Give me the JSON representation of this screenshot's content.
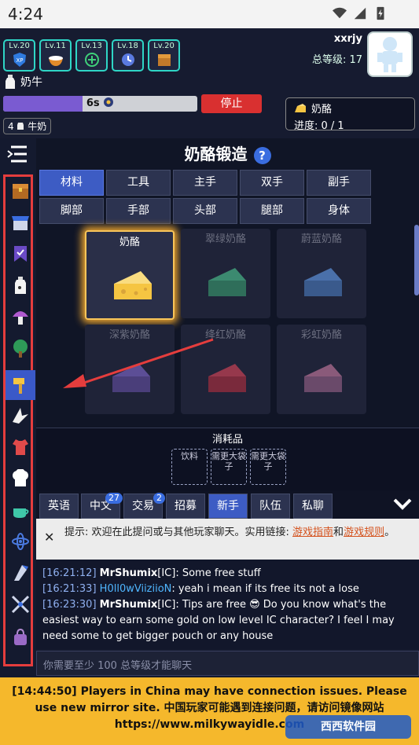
{
  "status_bar": {
    "time": "4:24"
  },
  "header": {
    "skills": [
      {
        "level": "Lv.20",
        "icon": "xp-shield-icon",
        "badge_text": "XP"
      },
      {
        "level": "Lv.11",
        "icon": "milk-bowl-icon"
      },
      {
        "level": "Lv.13",
        "icon": "plus-circle-icon"
      },
      {
        "level": "Lv.18",
        "icon": "clock-icon"
      },
      {
        "level": "Lv.20",
        "icon": "chest-icon"
      }
    ],
    "username": "xxrjy",
    "total_level": "总等级: 17",
    "current_action": "奶牛",
    "progress_text": "6s",
    "progress_fraction": 0.41,
    "stop_label": "停止",
    "queue": {
      "name": "奶酪",
      "progress": "进度: 0 / 1"
    },
    "item_count": "4",
    "item_name": "牛奶"
  },
  "main": {
    "title": "奶酪锻造",
    "tabs_row1": [
      "材料",
      "工具",
      "主手",
      "双手",
      "副手"
    ],
    "tabs_row2": [
      "脚部",
      "手部",
      "头部",
      "腿部",
      "身体"
    ],
    "active_tab": "材料",
    "tiles": [
      {
        "label": "奶酪",
        "selected": true,
        "color": "#f5c542"
      },
      {
        "label": "翠绿奶酪",
        "selected": false,
        "color": "#2f6e5a"
      },
      {
        "label": "蔚蓝奶酪",
        "selected": false,
        "color": "#3a5a8c"
      },
      {
        "label": "深紫奶酪",
        "selected": false,
        "color": "#4a3e7a"
      },
      {
        "label": "绛红奶酪",
        "selected": false,
        "color": "#7a2a3c"
      },
      {
        "label": "彩虹奶酪",
        "selected": false,
        "color": "#6a4a6a"
      }
    ]
  },
  "consumables": {
    "title": "消耗品",
    "slots": [
      "饮料",
      "需更大袋子",
      "需更大袋子"
    ]
  },
  "chat": {
    "tabs": [
      {
        "label": "英语",
        "count": ""
      },
      {
        "label": "中文",
        "count": "27"
      },
      {
        "label": "交易",
        "count": "2"
      },
      {
        "label": "招募",
        "count": ""
      },
      {
        "label": "新手",
        "count": ""
      },
      {
        "label": "队伍",
        "count": ""
      },
      {
        "label": "私聊",
        "count": ""
      }
    ],
    "active_tab": "新手",
    "tip_prefix": "提示: 欢迎在此提问或与其他玩家聊天。实用链接: ",
    "tip_link1": "游戏指南",
    "tip_and": "和",
    "tip_link2": "游戏规则",
    "tip_suffix": "。",
    "messages": [
      {
        "time": "[16:21:12]",
        "name": "MrShumix",
        "tag": "[IC]",
        "text": ": Some free stuff"
      },
      {
        "time": "[16:21:33]",
        "name": "H0ll0wViiziioN",
        "tag": "",
        "text": ": yeah i mean if its free its not a lose"
      },
      {
        "time": "[16:23:30]",
        "name": "MrShumix",
        "tag": "[IC]",
        "text": ": Tips are free 😎  Do you know what's the easiest way to earn some gold on low level IC character? I feel I may need some to get bigger pouch or any house"
      }
    ],
    "input_placeholder": "你需要至少 100 总等级才能聊天"
  },
  "announcement": {
    "text": "[14:44:50] Players in China may have connection issues. Please use new mirror site. 中国玩家可能遇到连接问题，请访问镜像网站 https://www.milkywayidle.com"
  },
  "watermark": "西西软件园"
}
